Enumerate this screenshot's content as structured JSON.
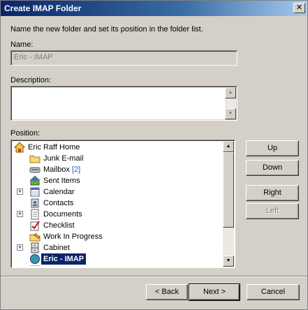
{
  "window": {
    "title": "Create IMAP Folder",
    "close_glyph": "✕"
  },
  "instructions": "Name the new folder and set its position in the folder list.",
  "name": {
    "label": "Name:",
    "value": "Eric - IMAP"
  },
  "description": {
    "label": "Description:",
    "value": ""
  },
  "position": {
    "label": "Position:",
    "tree": [
      {
        "label": "Eric Raff Home",
        "icon": "home-icon",
        "expander": ""
      },
      {
        "label": "Junk E-mail",
        "icon": "folder-icon",
        "expander": ""
      },
      {
        "label": "Mailbox",
        "count": "[2]",
        "icon": "mailbox-icon",
        "expander": ""
      },
      {
        "label": "Sent Items",
        "icon": "sent-items-icon",
        "expander": ""
      },
      {
        "label": "Calendar",
        "icon": "calendar-icon",
        "expander": "+"
      },
      {
        "label": "Contacts",
        "icon": "contacts-icon",
        "expander": ""
      },
      {
        "label": "Documents",
        "icon": "documents-icon",
        "expander": "+"
      },
      {
        "label": "Checklist",
        "icon": "checklist-icon",
        "expander": ""
      },
      {
        "label": "Work In Progress",
        "icon": "work-in-progress-icon",
        "expander": ""
      },
      {
        "label": "Cabinet",
        "icon": "cabinet-icon",
        "expander": "+"
      },
      {
        "label": "Eric - IMAP",
        "icon": "imap-globe-icon",
        "expander": "",
        "selected": true
      }
    ]
  },
  "side_buttons": {
    "up": "Up",
    "down": "Down",
    "right": "Right",
    "left": "Left"
  },
  "footer": {
    "back": "< Back",
    "next": "Next >",
    "cancel": "Cancel"
  },
  "colors": {
    "selection": "#0a246a",
    "title_start": "#0a246a",
    "title_end": "#a6caf0",
    "count": "#1a5fd0"
  }
}
